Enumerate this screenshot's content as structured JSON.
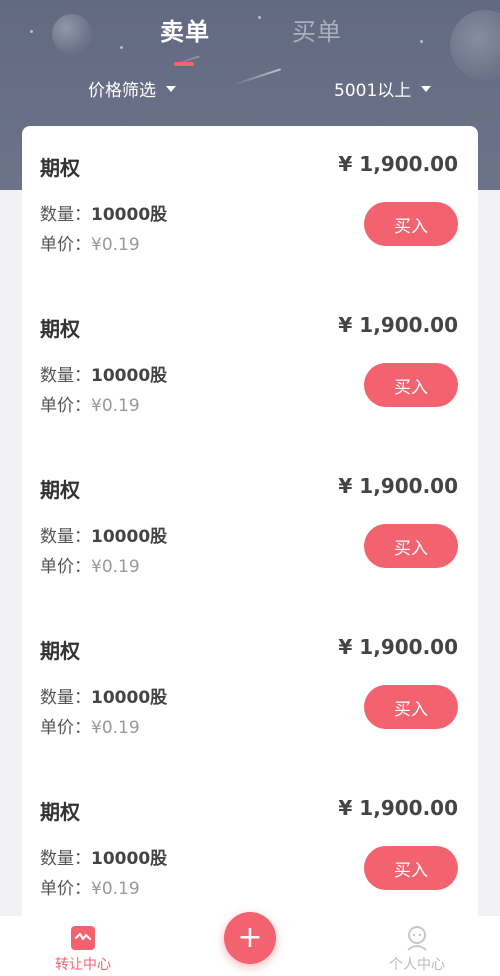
{
  "tabs": [
    {
      "label": "卖单",
      "active": true
    },
    {
      "label": "买单",
      "active": false
    }
  ],
  "filters": {
    "price": "价格筛选",
    "range": "5001以上"
  },
  "orders": [
    {
      "title": "期权",
      "price": "¥ 1,900.00",
      "qty_label": "数量：",
      "qty": "10000股",
      "unit_label": "单价：",
      "unit_price": "¥0.19",
      "button": "买入"
    },
    {
      "title": "期权",
      "price": "¥ 1,900.00",
      "qty_label": "数量：",
      "qty": "10000股",
      "unit_label": "单价：",
      "unit_price": "¥0.19",
      "button": "买入"
    },
    {
      "title": "期权",
      "price": "¥ 1,900.00",
      "qty_label": "数量：",
      "qty": "10000股",
      "unit_label": "单价：",
      "unit_price": "¥0.19",
      "button": "买入"
    },
    {
      "title": "期权",
      "price": "¥ 1,900.00",
      "qty_label": "数量：",
      "qty": "10000股",
      "unit_label": "单价：",
      "unit_price": "¥0.19",
      "button": "买入"
    },
    {
      "title": "期权",
      "price": "¥ 1,900.00",
      "qty_label": "数量：",
      "qty": "10000股",
      "unit_label": "单价：",
      "unit_price": "¥0.19",
      "button": "买入"
    }
  ],
  "bottom_nav": {
    "transfer": {
      "label": "转让中心",
      "icon": "transfer-center-icon"
    },
    "add": {
      "label": "+",
      "icon": "plus-icon"
    },
    "profile": {
      "label": "个人中心",
      "icon": "person-icon"
    }
  },
  "colors": {
    "header": "#626a82",
    "accent": "#f2636f",
    "background": "#f2f2f4"
  }
}
